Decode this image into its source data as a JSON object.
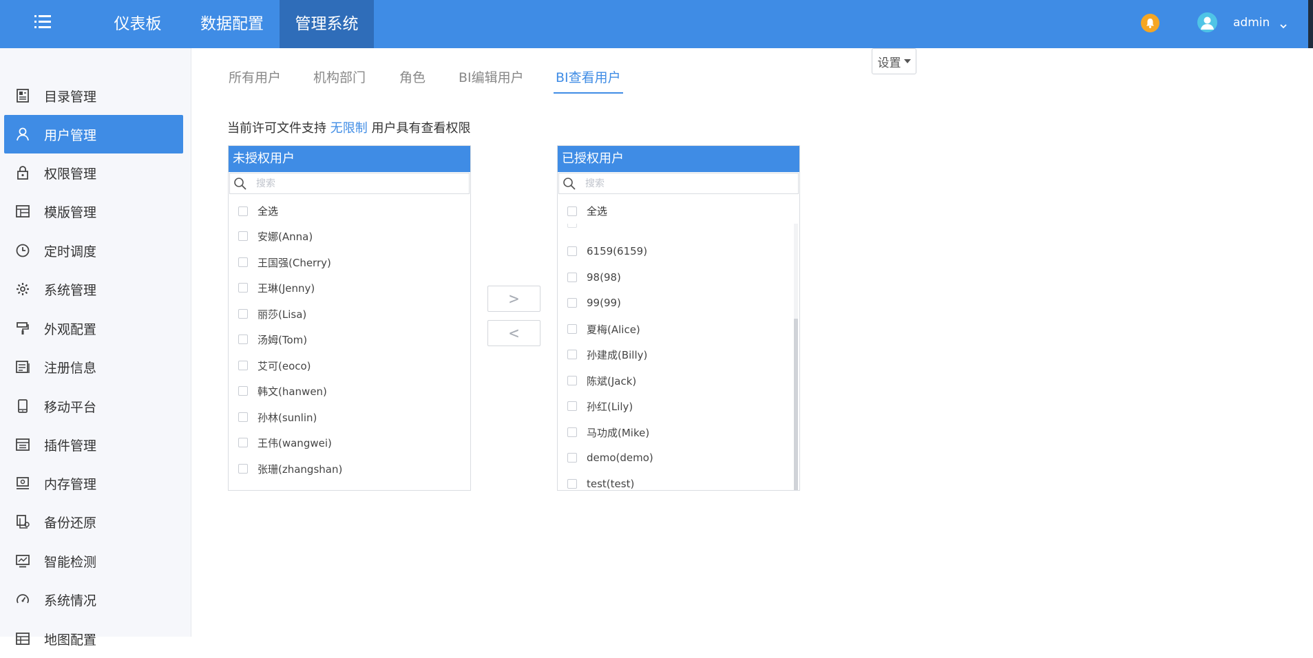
{
  "topbar": {
    "tabs": [
      "仪表板",
      "数据配置",
      "管理系统"
    ],
    "user": "admin",
    "colors": {
      "bar": "#3f8ce5",
      "active_tab": "#2f6db9",
      "bell": "#f5a623",
      "avatar": "#4fc4e6"
    }
  },
  "sidebar": {
    "items": [
      {
        "label": "目录管理",
        "icon": "catalog-icon"
      },
      {
        "label": "用户管理",
        "icon": "user-icon"
      },
      {
        "label": "权限管理",
        "icon": "lock-icon"
      },
      {
        "label": "模版管理",
        "icon": "template-icon"
      },
      {
        "label": "定时调度",
        "icon": "clock-icon"
      },
      {
        "label": "系统管理",
        "icon": "gear-icon"
      },
      {
        "label": "外观配置",
        "icon": "paint-roller-icon"
      },
      {
        "label": "注册信息",
        "icon": "registration-icon"
      },
      {
        "label": "移动平台",
        "icon": "mobile-icon"
      },
      {
        "label": "插件管理",
        "icon": "plugin-icon"
      },
      {
        "label": "内存管理",
        "icon": "memory-icon"
      },
      {
        "label": "备份还原",
        "icon": "backup-icon"
      },
      {
        "label": "智能检测",
        "icon": "monitor-icon"
      },
      {
        "label": "系统情况",
        "icon": "gauge-icon"
      },
      {
        "label": "地图配置",
        "icon": "map-icon"
      }
    ],
    "active_index": 1
  },
  "main": {
    "tabs": [
      "所有用户",
      "机构部门",
      "角色",
      "BI编辑用户",
      "BI查看用户"
    ],
    "active_tab_index": 4,
    "settings_label": "设置",
    "notice": {
      "before": "当前许可文件支持",
      "highlight": "无限制",
      "after": "用户具有查看权限"
    },
    "move_right_label": ">",
    "move_left_label": "<"
  },
  "unauthorized": {
    "title": "未授权用户",
    "search_placeholder": "搜索",
    "select_all": "全选",
    "users": [
      "安娜(Anna)",
      "王国强(Cherry)",
      "王琳(Jenny)",
      "丽莎(Lisa)",
      "汤姆(Tom)",
      "艾可(eoco)",
      "韩文(hanwen)",
      "孙林(sunlin)",
      "王伟(wangwei)",
      "张珊(zhangshan)"
    ]
  },
  "authorized": {
    "title": "已授权用户",
    "search_placeholder": "搜索",
    "select_all": "全选",
    "users": [
      "6159(6159)",
      "98(98)",
      "99(99)",
      "夏梅(Alice)",
      "孙建成(Billy)",
      "陈斌(Jack)",
      "孙红(Lily)",
      "马功成(Mike)",
      "demo(demo)",
      "test(test)"
    ]
  }
}
